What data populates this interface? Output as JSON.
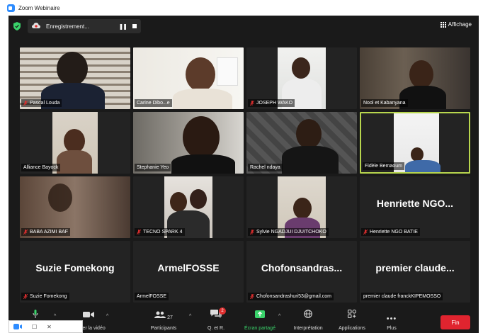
{
  "window": {
    "title": "Zoom Webinaire"
  },
  "top_bar": {
    "recording_label": "Enregistrement...",
    "view_label": "Affichage"
  },
  "participants": [
    {
      "name": "Pascal Louda",
      "muted": true
    },
    {
      "name": "Carine Dibo...e",
      "muted": false
    },
    {
      "name": "JOSEPH WAKO",
      "muted": true
    },
    {
      "name": "Nool et Kabanyana",
      "muted": false
    },
    {
      "name": "Alliance Bayock",
      "muted": false
    },
    {
      "name": "Stephanie Yeo",
      "muted": false
    },
    {
      "name": "Rachel ndaya",
      "muted": false
    },
    {
      "name": "Fidèle Bemaoum",
      "muted": false,
      "active_speaker": true
    },
    {
      "name": "BABA AZIMI BAF",
      "muted": true
    },
    {
      "name": "TECNO SPARK 4",
      "muted": true
    },
    {
      "name": "Sylvie NGADJUI DJUITCHOKO",
      "muted": true
    },
    {
      "name": "Henriette NGO BATIE",
      "muted": true,
      "display_name": "Henriette NGO..."
    },
    {
      "name": "Suzie Fomekong",
      "muted": true,
      "display_name": "Suzie Fomekong"
    },
    {
      "name": "ArmelFOSSE",
      "muted": false,
      "display_name": "ArmelFOSSE"
    },
    {
      "name": "Chofonsandrashuri53@gmail.com",
      "muted": true,
      "display_name": "Chofonsandras..."
    },
    {
      "name": "premier claude franckKIPEMOSSO",
      "muted": false,
      "display_name": "premier claude..."
    }
  ],
  "toolbar": {
    "video_label": "Arrêter la vidéo",
    "participants_label": "Participants",
    "participants_count": "27",
    "qa_label": "Q. et R.",
    "qa_badge": "2",
    "share_label": "Écran partagé",
    "interpretation_label": "Interprétation",
    "apps_label": "Applications",
    "more_label": "Plus",
    "end_label": "Fin"
  },
  "colors": {
    "accent_green": "#3ad36b",
    "active_border": "#b8d64e",
    "end_red": "#e0242f",
    "mute_red": "#e02f2f"
  }
}
